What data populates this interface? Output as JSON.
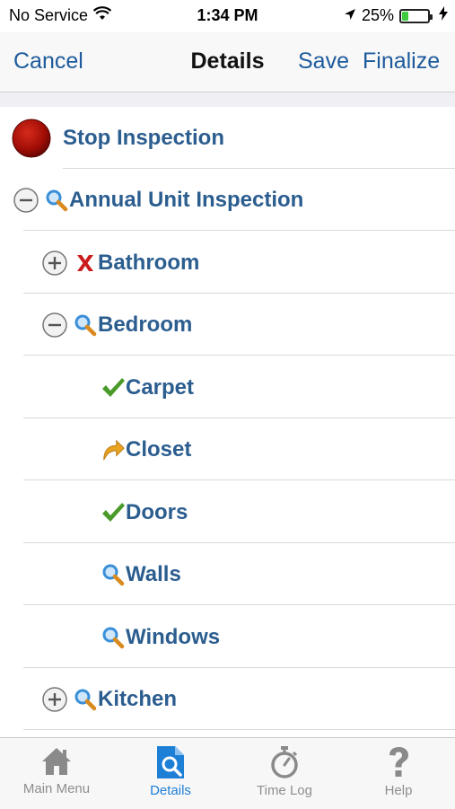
{
  "status": {
    "carrier": "No Service",
    "time": "1:34 PM",
    "battery": "25%",
    "battery_level": 0.25
  },
  "nav": {
    "cancel": "Cancel",
    "title": "Details",
    "save": "Save",
    "finalize": "Finalize"
  },
  "list": {
    "stop": "Stop Inspection",
    "items": [
      {
        "label": "Annual Unit Inspection",
        "icon": "search-icon"
      },
      {
        "label": "Bathroom",
        "icon": "x-mark-icon"
      },
      {
        "label": "Bedroom",
        "icon": "search-icon"
      },
      {
        "label": "Carpet",
        "icon": "checkmark-icon"
      },
      {
        "label": "Closet",
        "icon": "curved-arrow-icon"
      },
      {
        "label": "Doors",
        "icon": "checkmark-icon"
      },
      {
        "label": "Walls",
        "icon": "search-icon"
      },
      {
        "label": "Windows",
        "icon": "search-icon"
      },
      {
        "label": "Kitchen",
        "icon": "search-icon"
      }
    ]
  },
  "tabs": [
    {
      "label": "Main Menu",
      "icon": "home-icon"
    },
    {
      "label": "Details",
      "icon": "document-search-icon"
    },
    {
      "label": "Time Log",
      "icon": "stopwatch-icon"
    },
    {
      "label": "Help",
      "icon": "question-icon"
    }
  ],
  "colors": {
    "link": "#1e5b9c",
    "label": "#2b5d8f",
    "active_tab": "#1e7fd6",
    "stop_button": "#b01010",
    "check": "#4a9a2a",
    "x_mark": "#cc1b1b"
  }
}
